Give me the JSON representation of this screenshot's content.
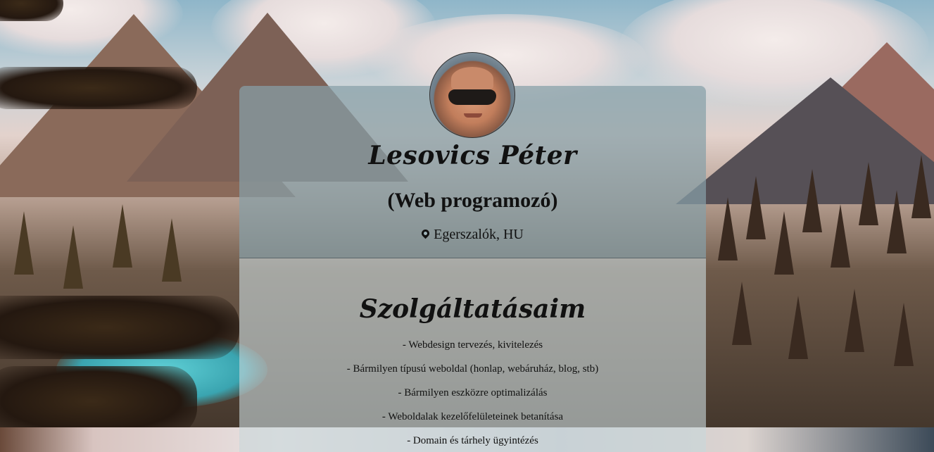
{
  "profile": {
    "name": "Lesovics Péter",
    "role": "(Web programozó)",
    "location": "Egerszalók, HU"
  },
  "services": {
    "title": "Szolgáltatásaim",
    "items": [
      "- Webdesign tervezés, kivitelezés",
      "- Bármilyen típusú weboldal (honlap, webáruház, blog, stb)",
      "- Bármilyen eszközre optimalizálás",
      "- Weboldalak kezelőfelületeinek betanítása",
      "- Domain és tárhely ügyintézés"
    ]
  },
  "icons": {
    "location": "map-marker-icon"
  },
  "colors": {
    "text": "#111111",
    "card_top": "#87a0a8",
    "card_bottom": "#c8d7da"
  }
}
